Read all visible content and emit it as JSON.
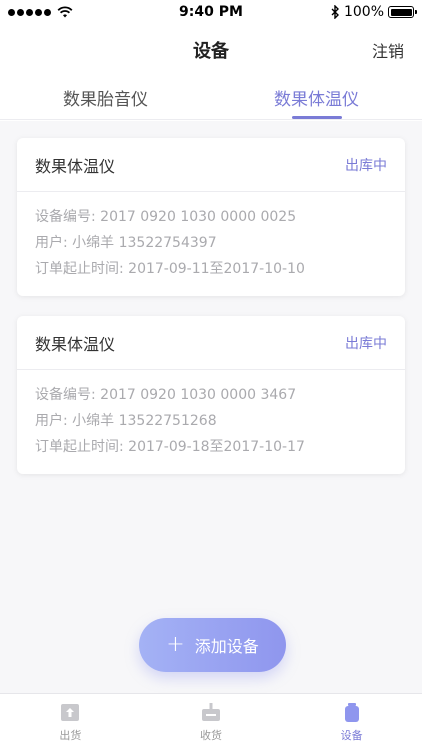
{
  "status_bar": {
    "time": "9:40 PM",
    "battery": "100%"
  },
  "nav": {
    "title": "设备",
    "right_action": "注销"
  },
  "tabs": [
    {
      "label": "数果胎音仪",
      "active": false
    },
    {
      "label": "数果体温仪",
      "active": true
    }
  ],
  "devices": [
    {
      "name": "数果体温仪",
      "status": "出库中",
      "serial": "设备编号: 2017 0920 1030 0000 0025",
      "user": "用户: 小绵羊 13522754397",
      "period": "订单起止时间: 2017-09-11至2017-10-10"
    },
    {
      "name": "数果体温仪",
      "status": "出库中",
      "serial": "设备编号: 2017 0920 1030 0000 3467",
      "user": "用户: 小绵羊 13522751268",
      "period": "订单起止时间: 2017-09-18至2017-10-17"
    }
  ],
  "add_button": {
    "icon": "plus-icon",
    "label": "添加设备"
  },
  "tab_bar": [
    {
      "label": "出货",
      "icon": "ship-out-icon",
      "active": false
    },
    {
      "label": "收货",
      "icon": "receive-icon",
      "active": false
    },
    {
      "label": "设备",
      "icon": "device-icon",
      "active": true
    }
  ],
  "colors": {
    "accent": "#7a7bd6",
    "muted": "#aaaaae"
  }
}
